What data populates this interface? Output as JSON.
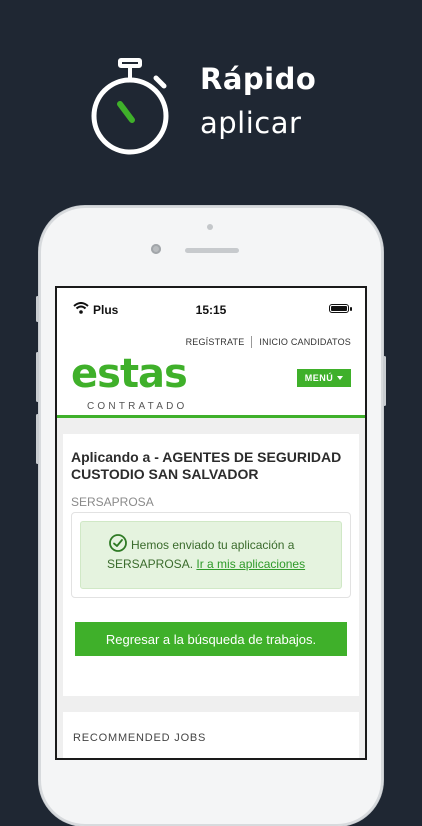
{
  "hero": {
    "icon": "stopwatch-icon",
    "title": "Rápido",
    "subtitle": "aplicar"
  },
  "status_bar": {
    "carrier": "Plus",
    "time": "15:15"
  },
  "header": {
    "links": [
      "REGÍSTRATE",
      "INICIO CANDIDATOS"
    ],
    "logo": "estas",
    "logo_sub": "CONTRATADO",
    "menu_label": "MENÚ"
  },
  "application": {
    "title": "Aplicando a - AGENTES DE SEGURIDAD CUSTODIO SAN SALVADOR",
    "company": "SERSAPROSA",
    "message_part1": "Hemos enviado tu aplicación a",
    "message_part2": "SERSAPROSA.",
    "message_link": "Ir a mis aplicaciones",
    "return_button": "Regresar a la búsqueda de trabajos."
  },
  "recommended": {
    "title": "RECOMMENDED JOBS"
  },
  "colors": {
    "brand_green": "#3fb02a",
    "background": "#1f2733",
    "success_bg": "#e5f3df"
  }
}
